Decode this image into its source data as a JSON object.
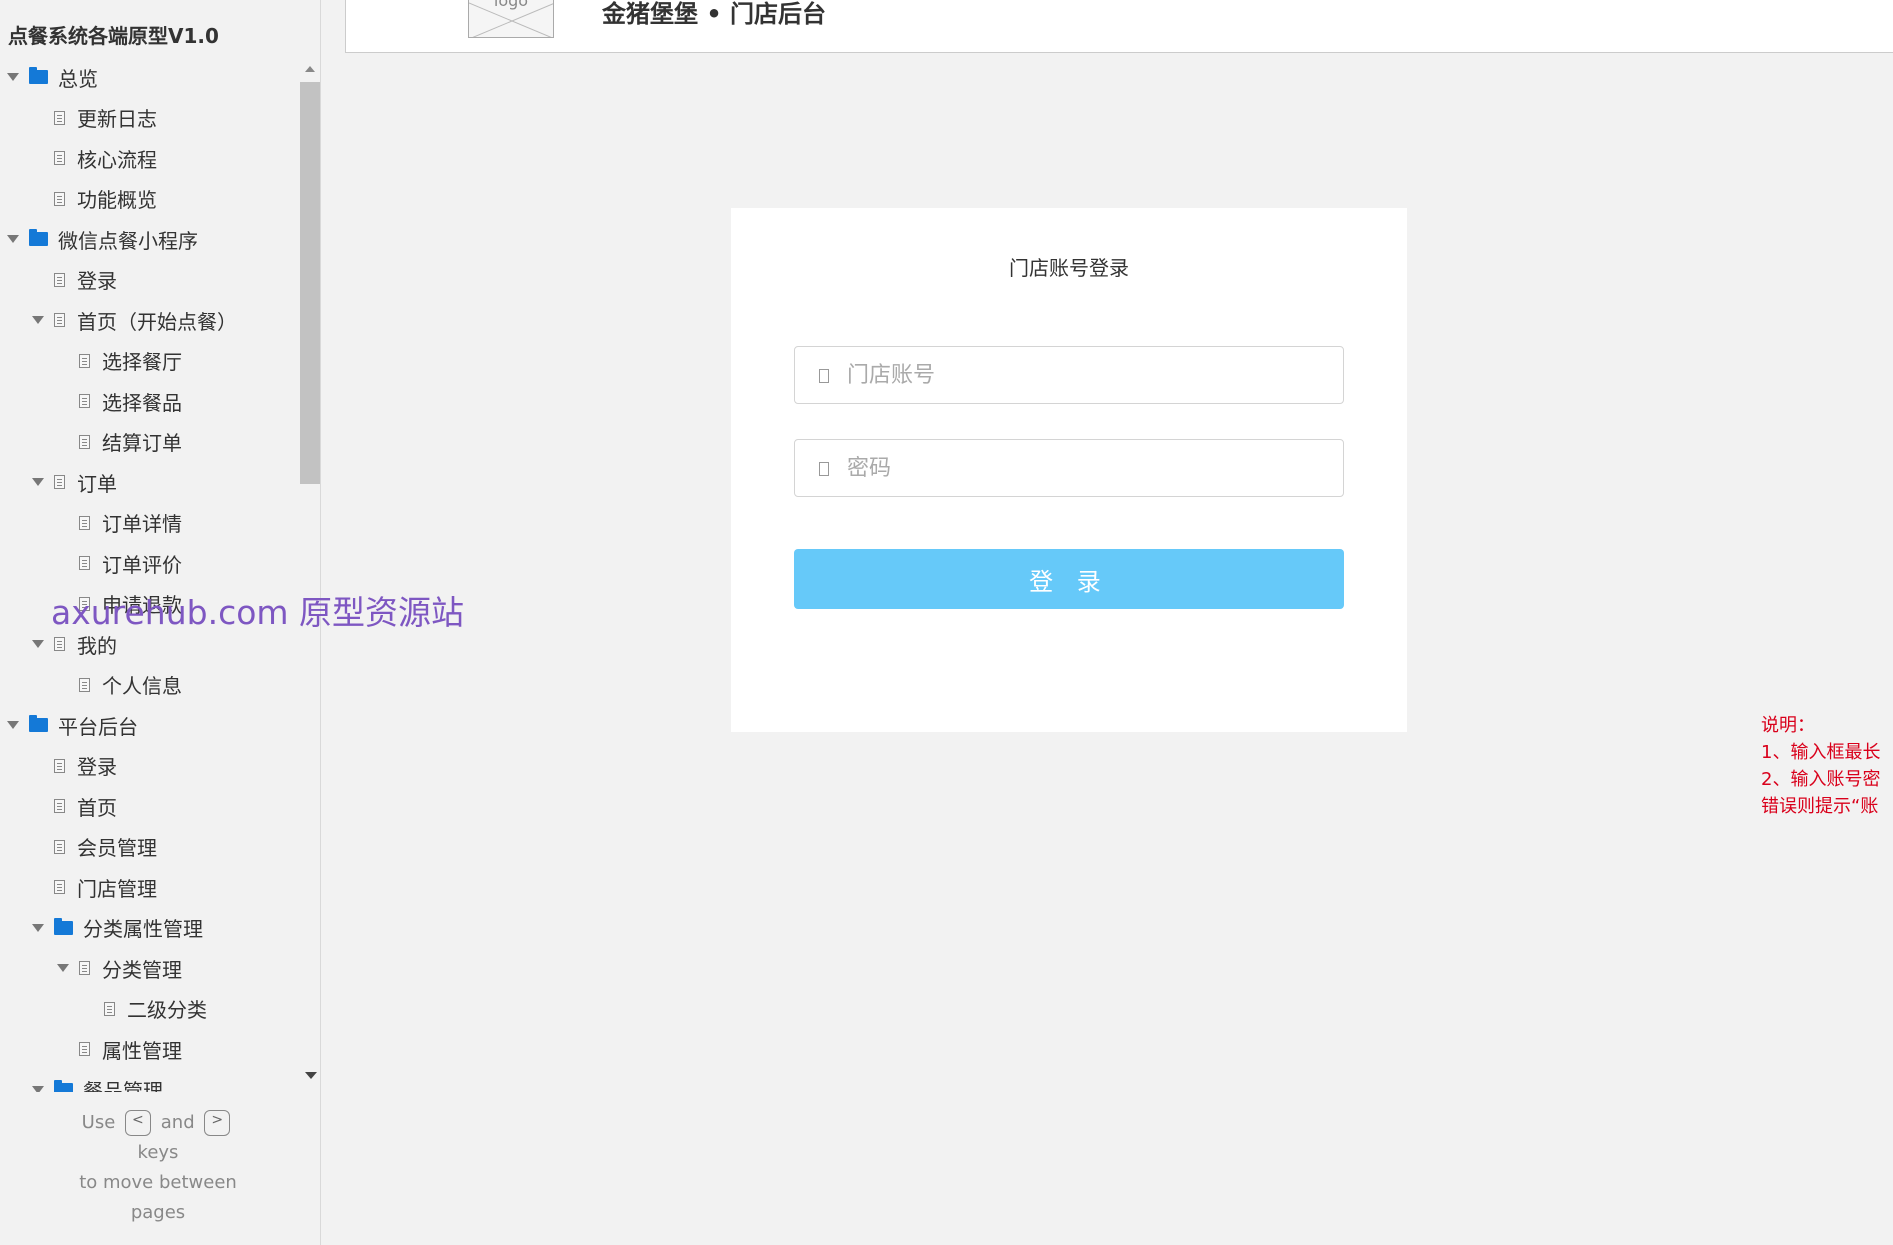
{
  "sidebar": {
    "project_title": "点餐系统各端原型V1.0",
    "tree": [
      {
        "label": "总览",
        "type": "folder",
        "level": 0,
        "expanded": true
      },
      {
        "label": "更新日志",
        "type": "page",
        "level": 1,
        "expanded": false
      },
      {
        "label": "核心流程",
        "type": "page",
        "level": 1,
        "expanded": false
      },
      {
        "label": "功能概览",
        "type": "page",
        "level": 1,
        "expanded": false
      },
      {
        "label": "微信点餐小程序",
        "type": "folder",
        "level": 0,
        "expanded": true
      },
      {
        "label": "登录",
        "type": "page",
        "level": 1,
        "expanded": false
      },
      {
        "label": "首页（开始点餐）",
        "type": "page",
        "level": 1,
        "expanded": true
      },
      {
        "label": "选择餐厅",
        "type": "page",
        "level": 2,
        "expanded": false
      },
      {
        "label": "选择餐品",
        "type": "page",
        "level": 2,
        "expanded": false
      },
      {
        "label": "结算订单",
        "type": "page",
        "level": 2,
        "expanded": false
      },
      {
        "label": "订单",
        "type": "page",
        "level": 1,
        "expanded": true
      },
      {
        "label": "订单详情",
        "type": "page",
        "level": 2,
        "expanded": false
      },
      {
        "label": "订单评价",
        "type": "page",
        "level": 2,
        "expanded": false
      },
      {
        "label": "申请退款",
        "type": "page",
        "level": 2,
        "expanded": false
      },
      {
        "label": "我的",
        "type": "page",
        "level": 1,
        "expanded": true
      },
      {
        "label": "个人信息",
        "type": "page",
        "level": 2,
        "expanded": false
      },
      {
        "label": "平台后台",
        "type": "folder",
        "level": 0,
        "expanded": true
      },
      {
        "label": "登录",
        "type": "page",
        "level": 1,
        "expanded": false
      },
      {
        "label": "首页",
        "type": "page",
        "level": 1,
        "expanded": false
      },
      {
        "label": "会员管理",
        "type": "page",
        "level": 1,
        "expanded": false
      },
      {
        "label": "门店管理",
        "type": "page",
        "level": 1,
        "expanded": false
      },
      {
        "label": "分类属性管理",
        "type": "folder",
        "level": 1,
        "expanded": true
      },
      {
        "label": "分类管理",
        "type": "page",
        "level": 2,
        "expanded": true
      },
      {
        "label": "二级分类",
        "type": "page",
        "level": 3,
        "expanded": false
      },
      {
        "label": "属性管理",
        "type": "page",
        "level": 2,
        "expanded": false
      },
      {
        "label": "餐品管理",
        "type": "folder",
        "level": 1,
        "expanded": true
      }
    ],
    "help": {
      "use": "Use",
      "key_prev": "<",
      "and": "and",
      "key_next": ">",
      "keys": "keys",
      "line2": "to move between",
      "line3": "pages"
    }
  },
  "header": {
    "logo_text": "logo",
    "brand": "金猪堡堡 • 门店后台"
  },
  "login": {
    "title": "门店账号登录",
    "account_placeholder": "门店账号",
    "password_placeholder": "密码",
    "button_label": "登 录"
  },
  "notes": {
    "lines": [
      "说明：",
      "1、输入框最长",
      "2、输入账号密",
      "错误则提示“账"
    ]
  },
  "watermark": "axurehub.com 原型资源站",
  "colors": {
    "folder": "#1479d7",
    "login_button": "#66c9f9",
    "note_text": "#d9001b",
    "watermark": "#7e57c2"
  }
}
